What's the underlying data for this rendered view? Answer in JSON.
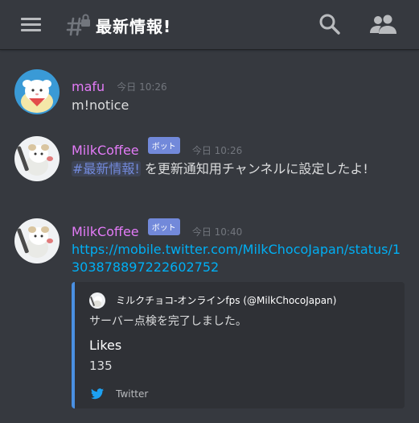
{
  "header": {
    "channel_name": "最新情報!",
    "icons": [
      "hamburger-menu-icon",
      "channel-locked-icon",
      "search-icon",
      "members-icon"
    ]
  },
  "colors": {
    "background": "#36393f",
    "username_color": "#e37bf7",
    "bot_tag": "#7289da",
    "link": "#00aff4",
    "embed_accent": "#4a90e2"
  },
  "messages": [
    {
      "author": "mafu",
      "timestamp": "今日 10:26",
      "content": "m!notice"
    },
    {
      "author": "MilkCoffee",
      "bot_tag": "ボット",
      "timestamp": "今日 10:26",
      "mention": "#最新情報!",
      "content_rest": " を更新通知用チャンネルに設定したよ!"
    },
    {
      "author": "MilkCoffee",
      "bot_tag": "ボット",
      "timestamp": "今日 10:40",
      "link": "https://mobile.twitter.com/MilkChocoJapan/status/1303878897222602752",
      "embed": {
        "author": "ミルクチョコ-オンラインfps (@MilkChocoJapan)",
        "description": "サーバー点検を完了しました。",
        "field_name": "Likes",
        "field_value": "135",
        "footer": "Twitter"
      }
    }
  ]
}
